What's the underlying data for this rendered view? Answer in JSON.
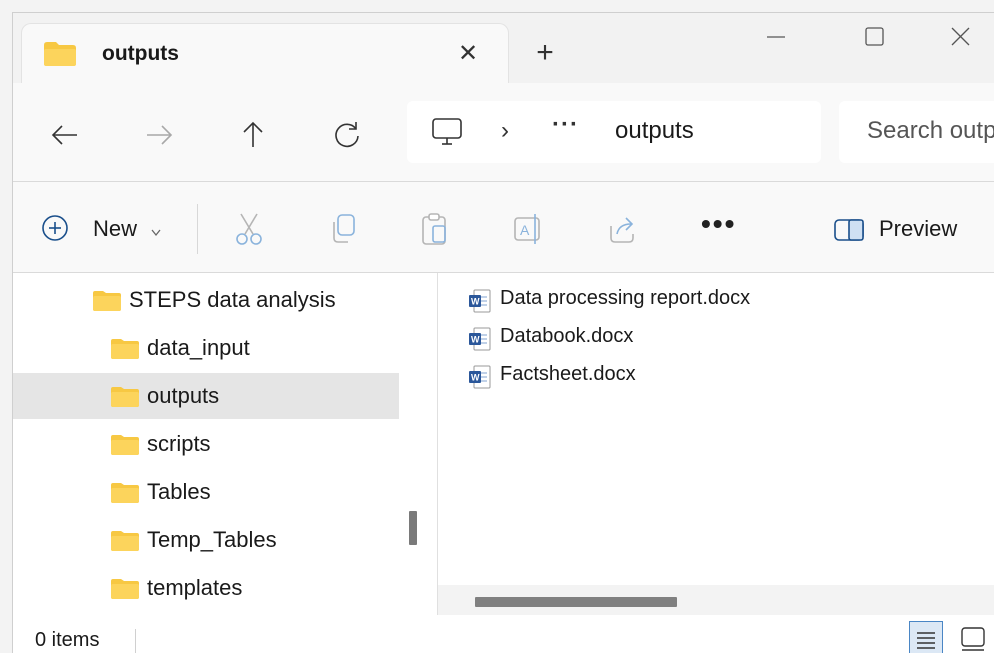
{
  "window": {
    "tab_title": "outputs",
    "tab_close_glyph": "✕",
    "new_tab_glyph": "+",
    "controls": [
      "minimize-icon",
      "maximize-icon",
      "close-icon"
    ]
  },
  "address_bar": {
    "location_icon": "computer-icon",
    "chevron": "›",
    "overflow": "···",
    "current_folder": "outputs"
  },
  "search": {
    "placeholder": "Search outputs"
  },
  "nav_buttons": [
    "back-icon",
    "forward-icon",
    "up-icon",
    "refresh-icon"
  ],
  "command_bar": {
    "new_label": "New",
    "buttons": [
      "cut-icon",
      "copy-icon",
      "paste-icon",
      "rename-icon",
      "share-icon"
    ],
    "more": "•••",
    "preview_label": "Preview"
  },
  "sidebar": {
    "items": [
      {
        "label": "STEPS data analysis",
        "selected": false
      },
      {
        "label": "data_input",
        "selected": false
      },
      {
        "label": "outputs",
        "selected": true
      },
      {
        "label": "scripts",
        "selected": false
      },
      {
        "label": "Tables",
        "selected": false
      },
      {
        "label": "Temp_Tables",
        "selected": false
      },
      {
        "label": "templates",
        "selected": false
      }
    ]
  },
  "files": [
    {
      "name": "Data processing report.docx",
      "icon": "word-document-icon"
    },
    {
      "name": "Databook.docx",
      "icon": "word-document-icon"
    },
    {
      "name": "Factsheet.docx",
      "icon": "word-document-icon"
    }
  ],
  "status": {
    "item_count": "0 items"
  },
  "colors": {
    "folder_yellow": "#f7c843",
    "selected_bg": "#e5e5e5",
    "word_blue": "#2b579a"
  }
}
